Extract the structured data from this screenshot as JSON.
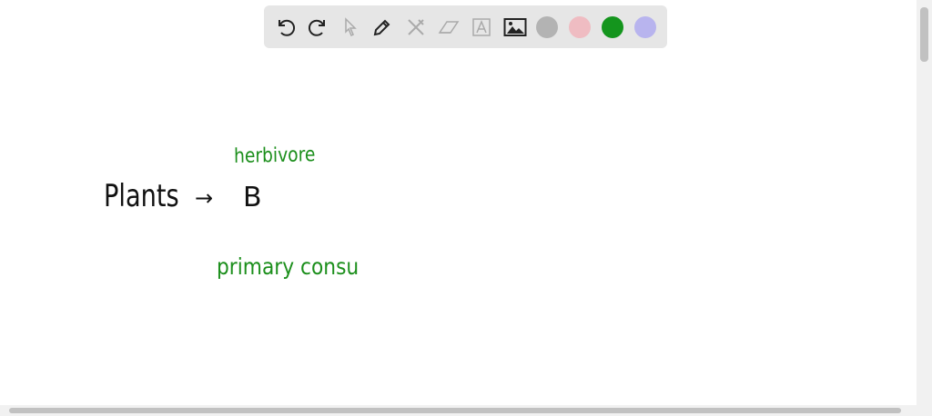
{
  "toolbar": {
    "tools": [
      "undo-icon",
      "redo-icon",
      "select-icon",
      "pen-icon",
      "tools-icon",
      "eraser-icon",
      "text-icon",
      "image-icon"
    ],
    "colors": [
      "#b3b3b3",
      "#efbcc2",
      "#14951d",
      "#b8b4ee"
    ],
    "selected_color": "#14951d"
  },
  "canvas": {
    "notes": {
      "plants": "Plants",
      "arrow": "→",
      "b": "B",
      "herbivore": "herbivore",
      "primary": "primary consu"
    },
    "ink_colors": {
      "black": "#111111",
      "green": "#1c8f1c"
    }
  }
}
